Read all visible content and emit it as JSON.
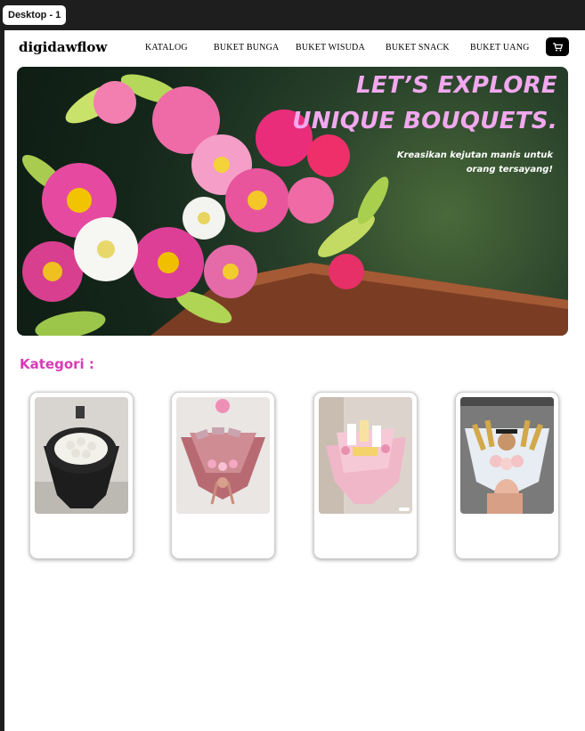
{
  "frame": {
    "label": "Desktop - 1"
  },
  "nav": {
    "brand": "digidawflow",
    "items": [
      "KATALOG",
      "BUKET BUNGA",
      "BUKET WISUDA",
      "BUKET SNACK",
      "BUKET UANG"
    ],
    "cart_icon": "cart-icon"
  },
  "hero": {
    "title_line1": "LET’S EXPLORE",
    "title_line2": "UNIQUE BOUQUETS.",
    "subtitle_line1": "Kreasikan kejutan manis untuk",
    "subtitle_line2": "orang tersayang!"
  },
  "section": {
    "heading": "Kategori :"
  },
  "categories": [
    {
      "image": "black-white-rose-bouquet"
    },
    {
      "image": "pink-money-bouquet"
    },
    {
      "image": "pink-snack-bouquet"
    },
    {
      "image": "graduation-teddy-bouquet"
    }
  ],
  "colors": {
    "accent_pink": "#d93bb4",
    "hero_title": "#f2a8ef",
    "frame_bg": "#1e1e1e"
  }
}
